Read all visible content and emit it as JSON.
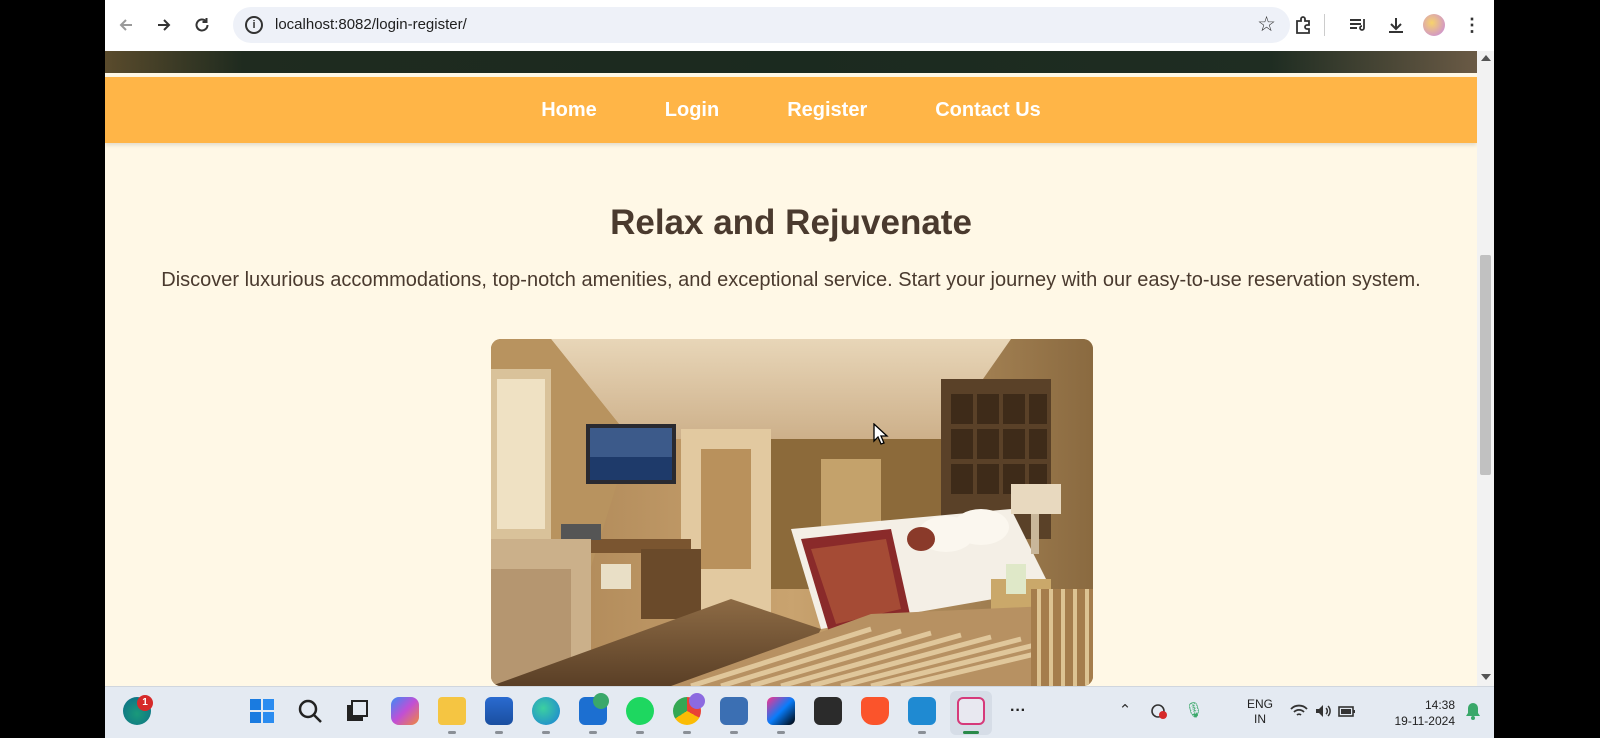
{
  "browser": {
    "url": "localhost:8082/login-register/",
    "back_icon": "arrow-left-icon",
    "forward_icon": "arrow-right-icon",
    "reload_icon": "reload-icon"
  },
  "nav": {
    "items": [
      {
        "label": "Home"
      },
      {
        "label": "Login"
      },
      {
        "label": "Register"
      },
      {
        "label": "Contact Us"
      }
    ],
    "bg_color": "#ffb547"
  },
  "main": {
    "title": "Relax and Rejuvenate",
    "description": "Discover luxurious accommodations, top-notch amenities, and exceptional service. Start your journey with our easy-to-use reservation system."
  },
  "taskbar": {
    "widget_badge": "1",
    "lang_line1": "ENG",
    "lang_line2": "IN",
    "time": "14:38",
    "date": "19-11-2024"
  }
}
